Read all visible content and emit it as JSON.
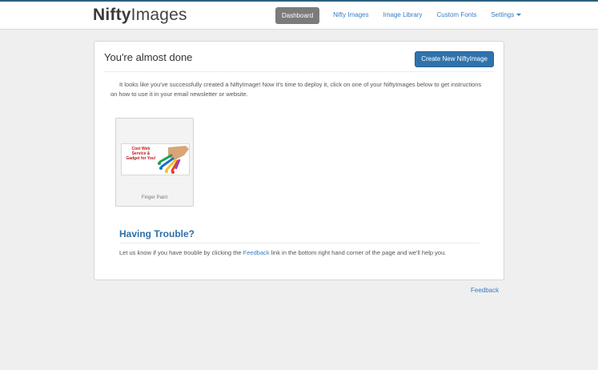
{
  "header": {
    "logo_bold": "Nifty",
    "logo_light": "Images",
    "nav": [
      {
        "label": "Dashboard"
      },
      {
        "label": "Nifty Images"
      },
      {
        "label": "Image Library"
      },
      {
        "label": "Custom Fonts"
      },
      {
        "label": "Settings"
      }
    ]
  },
  "panel": {
    "title": "You're almost done",
    "create_button": "Create New NiftyImage",
    "intro": "It looks like you've successfully created a NiftyImage! Now it's time to deploy it, click on one of your NiftyImages below to get instructions on how to use it in your email newsletter or website.",
    "images": [
      {
        "name": "Finger Paint",
        "thumb_text": "Cool Web Service & Gadget for You!"
      }
    ],
    "trouble": {
      "title": "Having Trouble?",
      "text_before": "Let us know if you have trouble by clicking the ",
      "link": "Feedback",
      "text_after": " link in the bottom right hand corner of the page and we'll help you."
    }
  },
  "footer": {
    "feedback": "Feedback"
  },
  "colors": {
    "accent": "#2f73ad",
    "link": "#3a7cc0",
    "active_nav": "#7b7b7b"
  }
}
